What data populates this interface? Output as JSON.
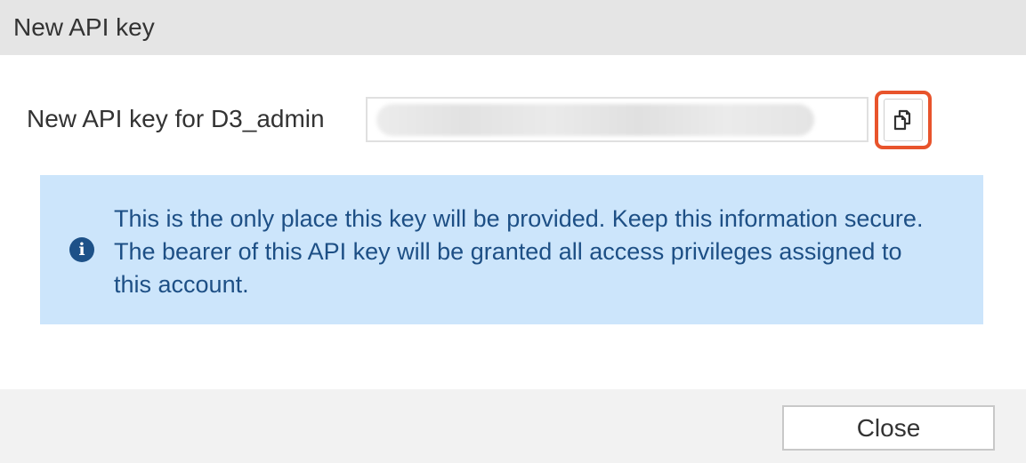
{
  "dialog": {
    "title": "New API key"
  },
  "api_key_field": {
    "label": "New API key for D3_admin",
    "value_obscured": true
  },
  "copy_button": {
    "icon": "copy-icon",
    "highlight_color": "#e8542c"
  },
  "info_message": {
    "icon": "info-circle-icon",
    "text": "This is the only place this key will be provided. Keep this information secure. The bearer of this API key will be granted all access privileges assigned to this account.",
    "background_color": "#cce5fb",
    "text_color": "#1d4f85"
  },
  "footer": {
    "close_label": "Close"
  }
}
